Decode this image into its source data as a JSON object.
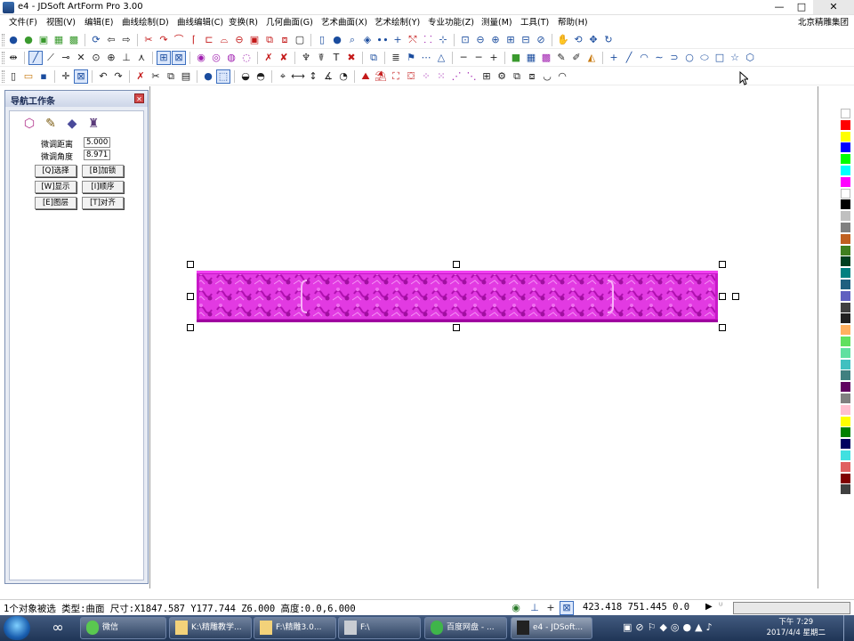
{
  "window": {
    "title": "e4 - JDSoft ArtForm Pro 3.00",
    "min_glyph": "—",
    "max_glyph": "□",
    "close_glyph": "✕"
  },
  "menubar": {
    "items": [
      "文件(F)",
      "视图(V)",
      "编辑(E)",
      "曲线绘制(D)",
      "曲线编辑(C)",
      "变换(R)",
      "几何曲面(G)",
      "艺术曲面(X)",
      "艺术绘制(Y)",
      "专业功能(Z)",
      "测量(M)",
      "工具(T)",
      "帮助(H)"
    ],
    "right_label": "北京精雕集团"
  },
  "nav_panel": {
    "title": "导航工作条",
    "close_glyph": "✕",
    "tabs": [
      "cube-icon",
      "brush-icon",
      "eraser-icon",
      "stamp-icon"
    ],
    "fine_distance_label": "微调距离",
    "fine_distance_value": "5.000",
    "fine_angle_label": "微调角度",
    "fine_angle_value": "8.971",
    "buttons": [
      "[Q]选择",
      "[B]加锁",
      "[W]显示",
      "[I]顺序",
      "[E]图层",
      "[T]对齐"
    ]
  },
  "palette_colors": [
    "#ffffff",
    "#ff0000",
    "#ffff00",
    "#0000ff",
    "#00ff00",
    "#00ffff",
    "#ff00ff",
    "#ffffff",
    "#000000",
    "#c0c0c0",
    "#808080",
    "#c06020",
    "#408020",
    "#004020",
    "#008080",
    "#206080",
    "#6060c0",
    "#404040",
    "#202020",
    "#ffb060",
    "#60e060",
    "#60e0a0",
    "#40c0c0",
    "#408080",
    "#600060",
    "#808080",
    "#ffc0d0",
    "#ffff00",
    "#008000",
    "#000060",
    "#40e0e0",
    "#e06060",
    "#800000",
    "#404040"
  ],
  "statusbar": {
    "left_text": "1个对象被选 类型:曲面 尺寸:X1847.587 Y177.744 Z6.000 高度:0.0,6.000",
    "coords": "423.418  751.445  0.0"
  },
  "taskbar": {
    "items": [
      "微信",
      "K:\\精雕教学...",
      "F:\\精雕3.0...",
      "F:\\",
      "百度网盘 - ...",
      "e4 - JDSoft..."
    ],
    "time": "下午 7:29",
    "date": "2017/4/4 星期二"
  }
}
